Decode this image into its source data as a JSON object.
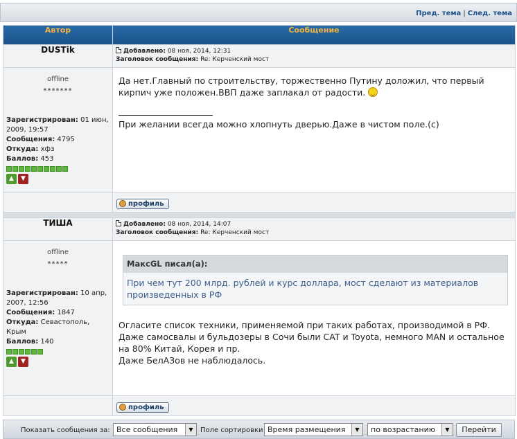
{
  "nav": {
    "prev_topic": "Пред. тема",
    "separator": "|",
    "next_topic": "След. тема"
  },
  "table": {
    "col_author": "Автор",
    "col_message": "Сообщение"
  },
  "posts": [
    {
      "author": "DUSTik",
      "added_label": "Добавлено:",
      "added_value": "08 ноя, 2014, 12:31",
      "subject_label": "Заголовок сообщения:",
      "subject_value": "Re: Керченский мост",
      "status": "offline",
      "stars": "*******",
      "registered_label": "Зарегистрирован:",
      "registered_value": "01 июн, 2009, 19:57",
      "messages_label": "Сообщения:",
      "messages_value": "4795",
      "from_label": "Откуда:",
      "from_value": "хфз",
      "points_label": "Баллов:",
      "points_value": "453",
      "rating_dots": 10,
      "text": "Да нет.Главный по строительству, торжественно Путину доложил, что первый кирпич уже положен.ВВП даже заплакал от радости.",
      "signature": "При желании всегда можно хлопнуть дверью.Даже в чистом поле.(c)",
      "profile_button": "профиль"
    },
    {
      "author": "ТИША",
      "added_label": "Добавлено:",
      "added_value": "08 ноя, 2014, 14:07",
      "subject_label": "Заголовок сообщения:",
      "subject_value": "Re: Керченский мост",
      "status": "offline",
      "stars": "*****",
      "registered_label": "Зарегистрирован:",
      "registered_value": "10 апр, 2007, 12:56",
      "messages_label": "Сообщения:",
      "messages_value": "1847",
      "from_label": "Откуда:",
      "from_value": "Севастополь, Крым",
      "points_label": "Баллов:",
      "points_value": "140",
      "rating_dots": 6,
      "quote_author": "МаксGL писал(а):",
      "quote_text": "При чем тут 200 млрд. рублей и курс доллара, мост сделают из материалов произведенных в РФ",
      "text_lines": [
        "Огласите список техники, применяемой при таких работах, производимой в РФ.",
        "Даже самосвалы и бульдозеры в Сочи были CAT и Toyota, немного MAN и остальное на 80% Китай, Корея и пр.",
        "Даже БелАЗов не наблюдалось."
      ],
      "profile_button": "профиль"
    }
  ],
  "bottom": {
    "show_label": "Показать сообщения за:",
    "show_value": "Все сообщения",
    "sort_label": "Поле сортировки",
    "sort_value": "Время размещения",
    "order_value": "по возрастанию",
    "go_button": "Перейти"
  },
  "icons": {
    "post": "post-icon",
    "vote_up": "thumbs-up-icon",
    "vote_down": "thumbs-down-icon",
    "profile": "user-icon",
    "smile": "smile-icon",
    "dropdown": "chevron-down-icon"
  },
  "colors": {
    "header_bg": "#185289",
    "header_text": "#f0b43c",
    "quote_text": "#3d5f8c",
    "rating_dot": "#5cb83a"
  }
}
